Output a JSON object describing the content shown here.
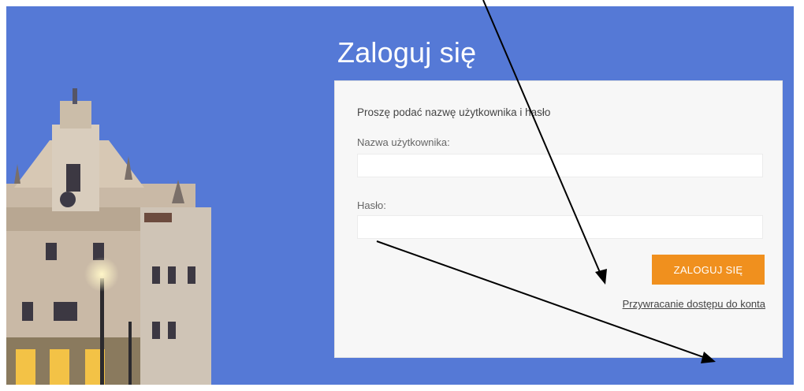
{
  "page": {
    "title": "Zaloguj się",
    "background_color": "#5579d6",
    "accent_color": "#f0901e"
  },
  "form": {
    "instruction": "Proszę podać nazwę użytkownika i hasło",
    "username_label": "Nazwa użytkownika:",
    "username_value": "",
    "password_label": "Hasło:",
    "password_value": "",
    "login_button": "ZALOGUJ SIĘ",
    "recover_link": "Przywracanie dostępu do konta"
  },
  "decor": {
    "illustration": "town-hall-photo",
    "annotation_arrows": [
      "arrow-to-recover-link",
      "arrow-to-card-bottom"
    ]
  }
}
